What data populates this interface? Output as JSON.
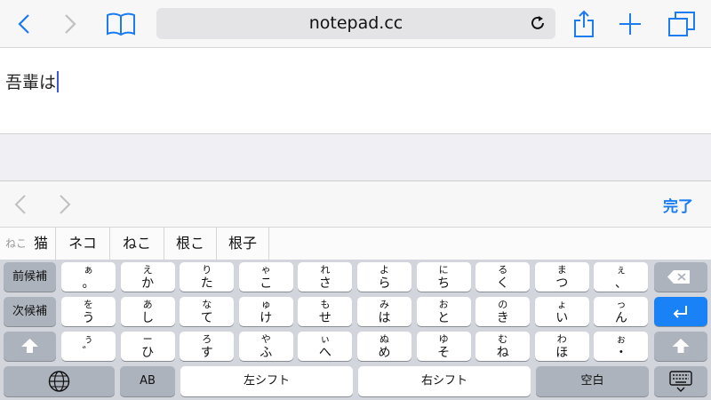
{
  "browser": {
    "url": "notepad.cc",
    "icons": [
      "back-icon",
      "forward-icon",
      "bookmarks-icon",
      "reload-icon",
      "share-icon",
      "new-tab-icon",
      "tabs-icon"
    ]
  },
  "editor": {
    "text": "吾輩は"
  },
  "accessory": {
    "done_label": "完了",
    "icons": [
      "prev-field-icon",
      "next-field-icon"
    ]
  },
  "candidates": {
    "reading": "ねこ",
    "items": [
      "猫",
      "ネコ",
      "ねこ",
      "根こ",
      "根子"
    ]
  },
  "keyboard": {
    "prev_candidate": "前候補",
    "next_candidate": "次候補",
    "row1": [
      [
        "ぁ",
        "。"
      ],
      [
        "え",
        "か"
      ],
      [
        "り",
        "た"
      ],
      [
        "ゃ",
        "こ"
      ],
      [
        "れ",
        "さ"
      ],
      [
        "よ",
        "ら"
      ],
      [
        "に",
        "ち"
      ],
      [
        "る",
        "く"
      ],
      [
        "ま",
        "つ"
      ],
      [
        "ぇ",
        "、"
      ]
    ],
    "row2": [
      [
        "を",
        "う"
      ],
      [
        "あ",
        "し"
      ],
      [
        "な",
        "て"
      ],
      [
        "ゅ",
        "け"
      ],
      [
        "も",
        "せ"
      ],
      [
        "み",
        "は"
      ],
      [
        "お",
        "と"
      ],
      [
        "の",
        "き"
      ],
      [
        "ょ",
        "い"
      ],
      [
        "っ",
        "ん"
      ]
    ],
    "row3": [
      [
        "ぅ",
        "゛"
      ],
      [
        "ー",
        "ひ"
      ],
      [
        "ろ",
        "す"
      ],
      [
        "や",
        "ふ"
      ],
      [
        "ぃ",
        "へ"
      ],
      [
        "ぬ",
        "め"
      ],
      [
        "ゆ",
        "そ"
      ],
      [
        "む",
        "ね"
      ],
      [
        "わ",
        "ほ"
      ],
      [
        "ぉ",
        "・"
      ]
    ],
    "ab_label": "AB",
    "left_shift": "左シフト",
    "right_shift": "右シフト",
    "space_label": "空白",
    "colors": {
      "enter": "#1a82f7",
      "accent": "#1a7cf0"
    }
  }
}
